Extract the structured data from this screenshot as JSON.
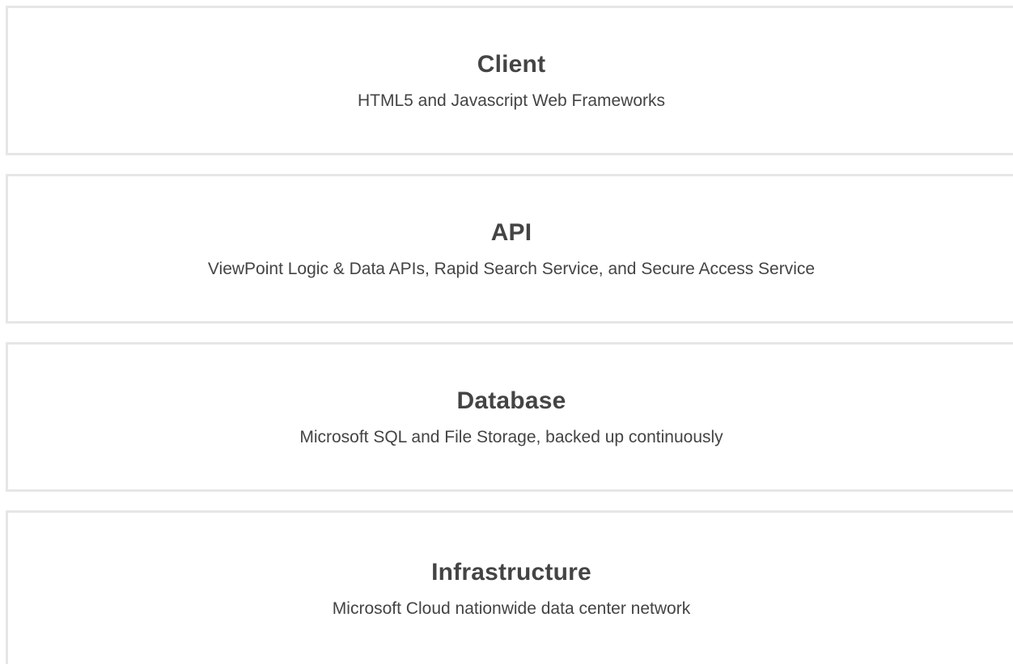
{
  "layers": [
    {
      "title": "Client",
      "description": "HTML5 and Javascript Web Frameworks"
    },
    {
      "title": "API",
      "description": "ViewPoint Logic & Data APIs, Rapid Search Service, and Secure Access Service"
    },
    {
      "title": "Database",
      "description": "Microsoft SQL and File Storage, backed up continuously"
    },
    {
      "title": "Infrastructure",
      "description": "Microsoft Cloud nationwide data center network"
    }
  ]
}
